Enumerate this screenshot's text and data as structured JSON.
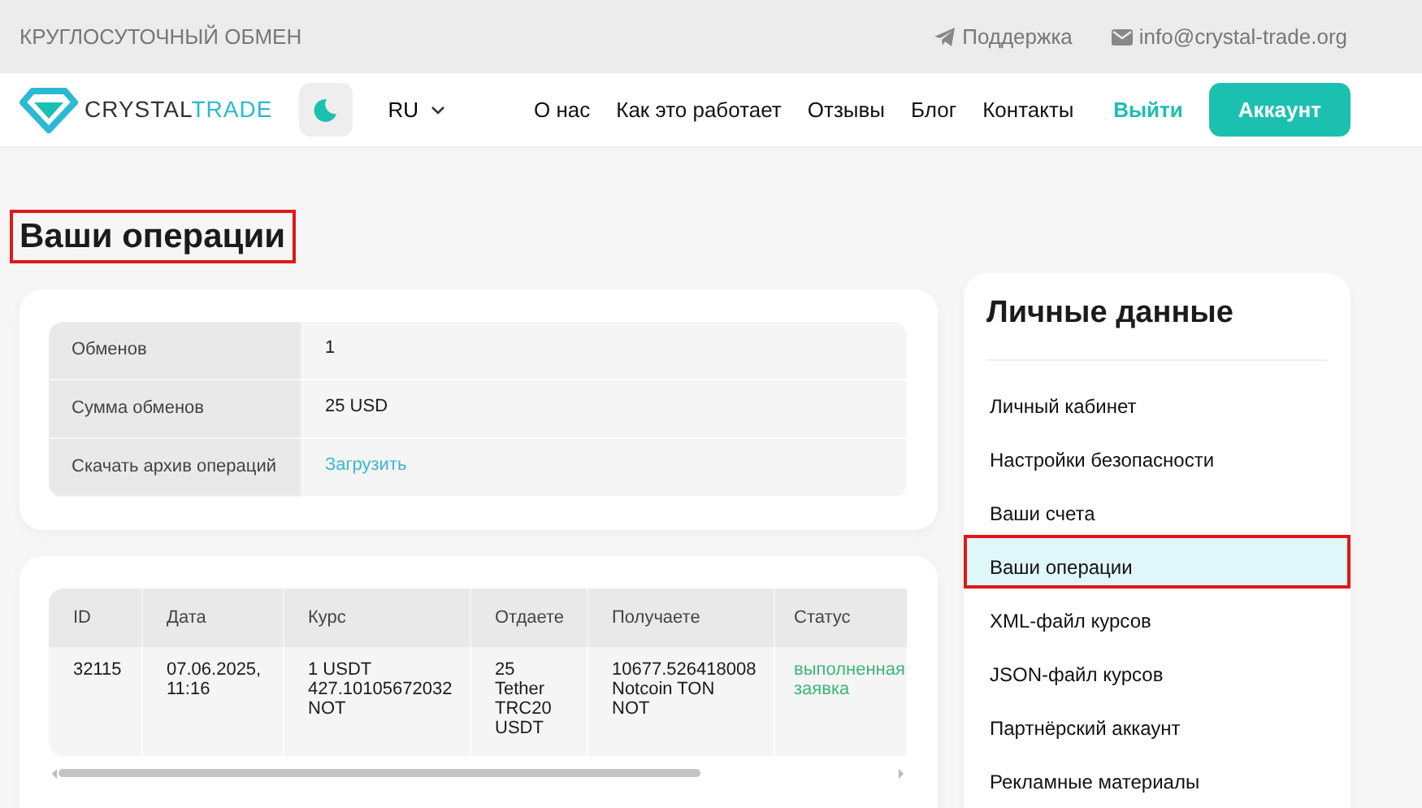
{
  "topbar": {
    "tagline": "КРУГЛОСУТОЧНЫЙ ОБМЕН",
    "support": "Поддержка",
    "email": "info@crystal-trade.org"
  },
  "header": {
    "logo": {
      "part_1": "CRYSTAL",
      "part_2": "TRADE"
    },
    "language": "RU",
    "nav": [
      "О нас",
      "Как это работает",
      "Отзывы",
      "Блог",
      "Контакты"
    ],
    "logout": "Выйти",
    "account": "Аккаунт"
  },
  "heading": {
    "text": "Ваши операции",
    "highlighted": true
  },
  "summary": [
    {
      "label": "Обменов",
      "value": "1",
      "kind": "text"
    },
    {
      "label": "Сумма обменов",
      "value": "25 USD",
      "kind": "text"
    },
    {
      "label": "Скачать архив операций",
      "value": "Загрузить",
      "kind": "link"
    }
  ],
  "operations": {
    "columns": [
      "ID",
      "Дата",
      "Курс",
      "Отдаете",
      "Получаете",
      "Статус"
    ],
    "rows": [
      {
        "cells": [
          "32115",
          "07.06.2025, 11:16",
          "1 USDT 427.10105672032 NOT",
          "25 Tether TRC20 USDT",
          "10677.526418008 Notcoin TON NOT",
          "выполненная заявка"
        ]
      }
    ]
  },
  "sidebar": {
    "title": "Личные данные",
    "items": [
      {
        "label": "Личный кабинет",
        "selected": false
      },
      {
        "label": "Настройки безопасности",
        "selected": false
      },
      {
        "label": "Ваши счета",
        "selected": false
      },
      {
        "label": "Ваши операции",
        "selected": true
      },
      {
        "label": "XML-файл курсов",
        "selected": false
      },
      {
        "label": "JSON-файл курсов",
        "selected": false
      },
      {
        "label": "Партнёрский аккаунт",
        "selected": false
      },
      {
        "label": "Рекламные материалы",
        "selected": false
      }
    ]
  }
}
